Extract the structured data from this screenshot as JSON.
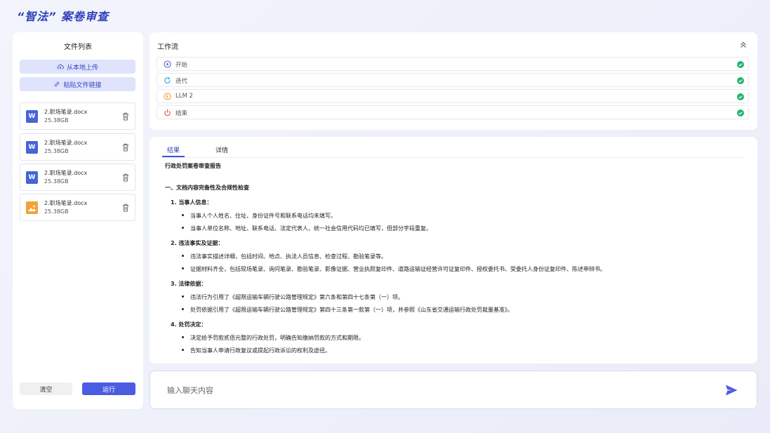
{
  "app": {
    "title": "“智法” 案卷审查"
  },
  "files": {
    "title": "文件列表",
    "upload_label": "从本地上传",
    "paste_label": "粘贴文件链接",
    "items": [
      {
        "name": "2.职场笔录.docx",
        "size": "25.38GB",
        "type_icon": "word-doc-icon"
      },
      {
        "name": "2.职场笔录.docx",
        "size": "25.38GB",
        "type_icon": "word-doc-icon"
      },
      {
        "name": "2.职场笔录.docx",
        "size": "25.38GB",
        "type_icon": "word-doc-icon"
      },
      {
        "name": "2.职场笔录.docx",
        "size": "25.38GB",
        "type_icon": "image-file-icon"
      }
    ],
    "clear_label": "清空",
    "run_label": "运行"
  },
  "workflow": {
    "title": "工作流",
    "steps": [
      {
        "label": "开始",
        "icon": "play-icon",
        "status": "done"
      },
      {
        "label": "迭代",
        "icon": "iterate-icon",
        "status": "done"
      },
      {
        "label": "LLM 2",
        "icon": "llm-icon",
        "status": "done"
      },
      {
        "label": "结束",
        "icon": "power-icon",
        "status": "done"
      }
    ]
  },
  "result": {
    "tabs": [
      {
        "label": "结果",
        "active": true
      },
      {
        "label": "详情",
        "active": false
      }
    ],
    "report_title": "行政处罚案卷审查报告",
    "section1": "一、文档内容完备性及合规性检查",
    "sub1": {
      "title": "1. 当事人信息：",
      "items": [
        "当事人个人姓名、住址、身份证件号和联系电话均未填写。",
        "当事人单位名称、地址、联系电话、法定代表人、统一社会信用代码均已填写，但部分字段重复。"
      ]
    },
    "sub2": {
      "title": "2. 违法事实及证据：",
      "items": [
        "违法事实描述详细，包括时间、地点、执法人员信息、检查过程、勘验笔录等。",
        "证据材料齐全，包括现场笔录、询问笔录、勘验笔录、影像证据、营业执照复印件、道路运输证经营许可证复印件、授权委托书、受委托人身份证复印件、陈述申辩书。"
      ]
    },
    "sub3": {
      "title": "3. 法律依据：",
      "items": [
        "违法行为引用了《超限运输车辆行驶公路管理规定》第六条和第四十七条第（一）项。",
        "处罚依据引用了《超限运输车辆行驶公路管理规定》第四十三条第一款第（一）项，并参照《山东省交通运输行政处罚裁量基准》。"
      ]
    },
    "sub4": {
      "title": "4. 处罚决定：",
      "items": [
        "决定给予罚款贰佰元整的行政处罚，明确告知缴纳罚款的方式和期限。",
        "告知当事人申请行政复议或提起行政诉讼的权利及途径。"
      ]
    }
  },
  "chat": {
    "placeholder": "输入聊天内容",
    "send_icon": "send-icon"
  },
  "colors": {
    "accent": "#4c5ce0",
    "brand": "#2f3fb8",
    "success": "#22b573"
  }
}
